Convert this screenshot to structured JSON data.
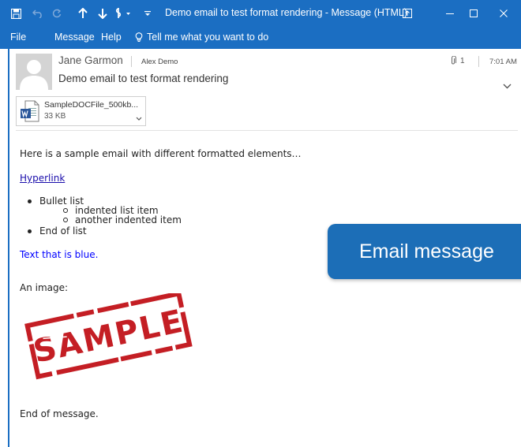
{
  "window": {
    "title": "Demo email to test format rendering  -  Message (HTML)",
    "accent_color": "#1b6ec2"
  },
  "ribbon": {
    "tabs": [
      "File",
      "Message",
      "Help"
    ],
    "tell_me": "Tell me what you want to do"
  },
  "header": {
    "sender": "Jane Garmon",
    "recipient": "Alex Demo",
    "attachment_count": "1",
    "time": "7:01 AM",
    "subject": "Demo email to test format rendering"
  },
  "attachment": {
    "name": "SampleDOCFile_500kb...",
    "size": "33 KB",
    "icon": "word-doc-icon"
  },
  "body": {
    "intro": "Here is a sample email with different formatted elements…",
    "hyperlink": "Hyperlink",
    "list": {
      "item1": "Bullet list",
      "sub1": "indented list item",
      "sub2": "another indented item",
      "item2": "End of list"
    },
    "blue_text": "Text that is blue.",
    "blue_color": "#0000ff",
    "image_label": "An image:",
    "stamp_text": "SAMPLE",
    "stamp_color": "#c41e24",
    "ending": "End of message."
  },
  "callout": {
    "text": "Email message",
    "color": "#1c6eb7"
  }
}
